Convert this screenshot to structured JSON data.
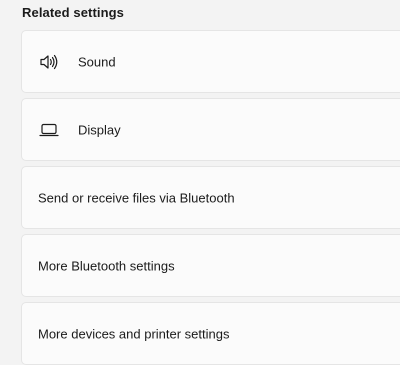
{
  "section": {
    "title": "Related settings"
  },
  "items": [
    {
      "label": "Sound",
      "icon": "speaker-icon"
    },
    {
      "label": "Display",
      "icon": "monitor-icon"
    },
    {
      "label": "Send or receive files via Bluetooth"
    },
    {
      "label": "More Bluetooth settings"
    },
    {
      "label": "More devices and printer settings"
    }
  ]
}
